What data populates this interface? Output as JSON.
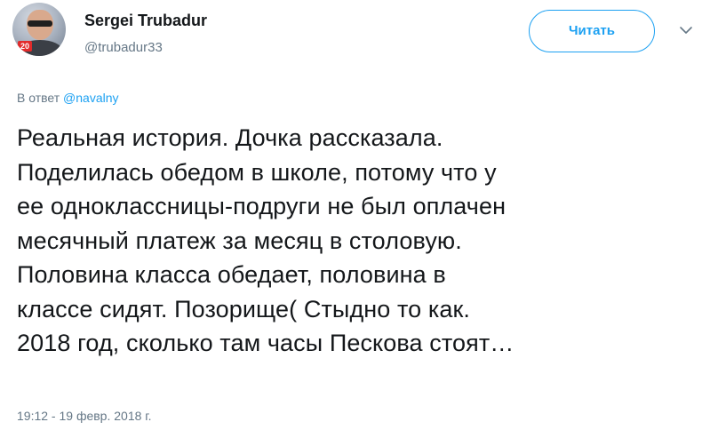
{
  "user": {
    "name": "Sergei Trubadur",
    "handle": "@trubadur33",
    "avatar_badge": "20"
  },
  "follow_button": {
    "label": "Читать"
  },
  "menu": {
    "icon": "chevron-down-icon"
  },
  "reply": {
    "prefix": "В ответ",
    "mention": "@navalny"
  },
  "tweet": {
    "text": "Реальная история. Дочка рассказала.\nПоделилась обедом в школе, потому что у\nее одноклассницы-подруги не был оплачен\nмесячный платеж за месяц в столовую.\nПоловина класса обедает, половина в\nклассе сидят. Позорище( Стыдно то как.\n2018 год, сколько там часы Пескова стоят…",
    "timestamp": "19:12 - 19 февр. 2018 г."
  },
  "colors": {
    "accent": "#1da1f2",
    "secondary_text": "#657786",
    "primary_text": "#14171a"
  }
}
